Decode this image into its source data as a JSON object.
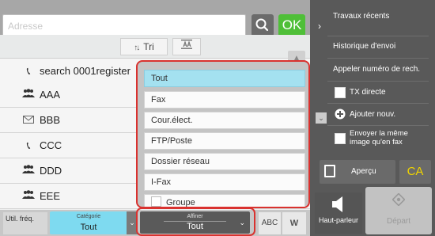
{
  "address_bar": {
    "placeholder": "Adresse",
    "ok_label": "OK"
  },
  "sort": {
    "label": "Tri"
  },
  "address_list": [
    {
      "icon": "phone-icon",
      "label": "search 0001register"
    },
    {
      "icon": "group-icon",
      "label": "AAA"
    },
    {
      "icon": "email-icon",
      "label": "BBB"
    },
    {
      "icon": "phone-icon",
      "label": "CCC"
    },
    {
      "icon": "group-icon",
      "label": "DDD"
    },
    {
      "icon": "group-icon",
      "label": "EEE"
    }
  ],
  "dropdown": {
    "options": [
      "Tout",
      "Fax",
      "Cour.élect.",
      "FTP/Poste",
      "Dossier réseau",
      "I-Fax",
      "Groupe"
    ],
    "selected": "Tout"
  },
  "bottom_bar": {
    "util_label": "Util. fréq.",
    "category_caption": "Catégorie",
    "category_value": "Tout",
    "refine_caption": "Affiner",
    "refine_value": "Tout",
    "abc_label": "ABC",
    "w_label": "W"
  },
  "right_panel": {
    "recent_jobs": "Travaux récents",
    "send_history": "Historique d'envoi",
    "call_search": "Appeler numéro de rech.",
    "tx_direct": "TX directe",
    "add_new": "Ajouter nouv.",
    "send_same": "Envoyer la même image qu'en fax",
    "preview": "Aperçu",
    "ca": "CA",
    "speaker": "Haut-parleur",
    "start": "Départ"
  },
  "colors": {
    "accent_green": "#4fbf38",
    "highlight_cyan": "#7edaf0",
    "alert_red": "#d9322f",
    "ca_yellow": "#f0d400"
  }
}
